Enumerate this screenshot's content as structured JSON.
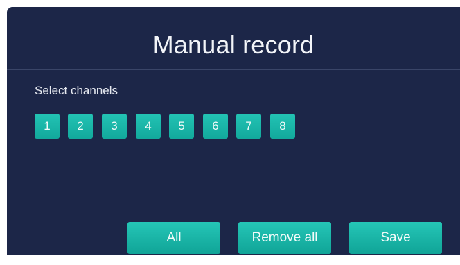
{
  "dialog": {
    "title": "Manual record",
    "select_label": "Select channels"
  },
  "channels": [
    "1",
    "2",
    "3",
    "4",
    "5",
    "6",
    "7",
    "8"
  ],
  "actions": {
    "all_label": "All",
    "remove_all_label": "Remove all",
    "save_label": "Save"
  },
  "colors": {
    "dialog_background": "#1c2648",
    "accent_teal": "#1ab5a8",
    "text": "#f2f4f8"
  }
}
